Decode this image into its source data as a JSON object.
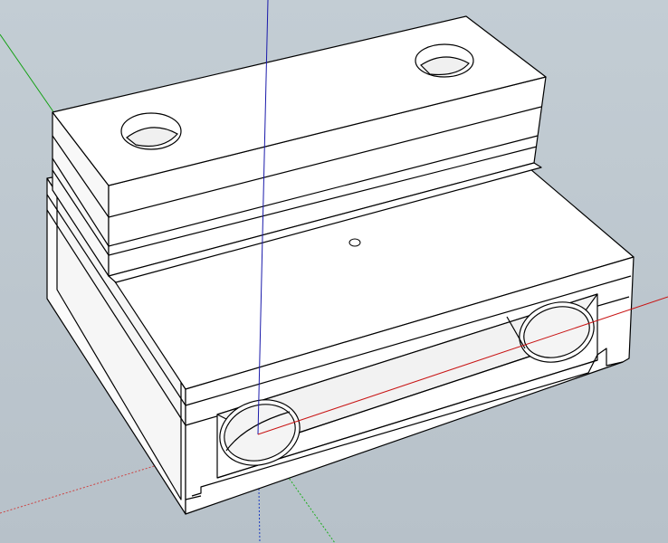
{
  "scene": {
    "background_color": "#bcc7ce",
    "face_color": "#ffffff",
    "face_shadow_color": "#f0f0f0",
    "edge_color": "#000000",
    "axis_colors": {
      "red": "#d00000",
      "green": "#00a000",
      "blue": "#0000c0"
    }
  }
}
